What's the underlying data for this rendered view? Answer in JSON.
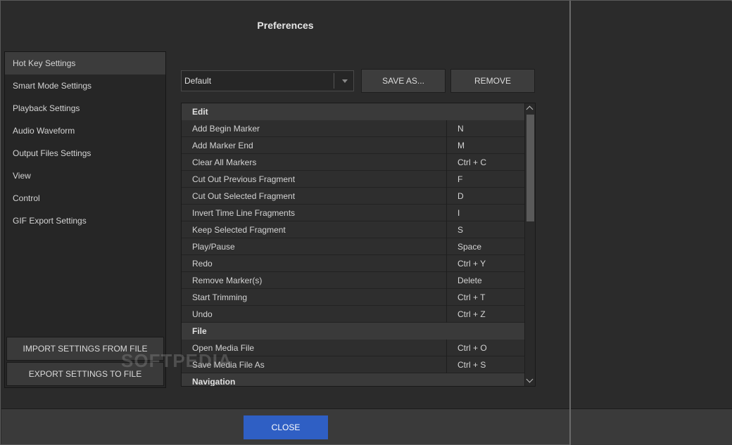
{
  "dialog": {
    "title": "Preferences"
  },
  "sidebar": {
    "items": [
      {
        "label": "Hot Key Settings",
        "active": true
      },
      {
        "label": "Smart Mode Settings"
      },
      {
        "label": "Playback Settings"
      },
      {
        "label": "Audio Waveform"
      },
      {
        "label": "Output Files Settings"
      },
      {
        "label": "View"
      },
      {
        "label": "Control"
      },
      {
        "label": "GIF Export Settings"
      }
    ],
    "import_label": "IMPORT SETTINGS FROM FILE",
    "export_label": "EXPORT SETTINGS TO FILE"
  },
  "toolbar": {
    "preset_value": "Default",
    "save_as_label": "SAVE AS...",
    "remove_label": "REMOVE"
  },
  "hotkeys": {
    "groups": [
      {
        "name": "Edit",
        "rows": [
          {
            "command": "Add Begin Marker",
            "key": "N"
          },
          {
            "command": "Add Marker End",
            "key": "M"
          },
          {
            "command": "Clear All Markers",
            "key": "Ctrl + C"
          },
          {
            "command": "Cut Out Previous Fragment",
            "key": "F"
          },
          {
            "command": "Cut Out Selected Fragment",
            "key": "D"
          },
          {
            "command": "Invert Time Line Fragments",
            "key": "I"
          },
          {
            "command": "Keep Selected Fragment",
            "key": "S"
          },
          {
            "command": "Play/Pause",
            "key": "Space"
          },
          {
            "command": "Redo",
            "key": "Ctrl + Y"
          },
          {
            "command": "Remove Marker(s)",
            "key": "Delete"
          },
          {
            "command": "Start Trimming",
            "key": "Ctrl + T"
          },
          {
            "command": "Undo",
            "key": "Ctrl + Z"
          }
        ]
      },
      {
        "name": "File",
        "rows": [
          {
            "command": "Open Media File",
            "key": "Ctrl + O"
          },
          {
            "command": "Save Media File As",
            "key": "Ctrl + S"
          }
        ]
      },
      {
        "name": "Navigation",
        "rows": []
      }
    ]
  },
  "footer": {
    "close_label": "CLOSE"
  },
  "watermark": {
    "text": "SOFTPEDIA"
  },
  "colors": {
    "accent": "#2f5fc4",
    "background": "#2b2b2b",
    "panel": "#262626"
  }
}
